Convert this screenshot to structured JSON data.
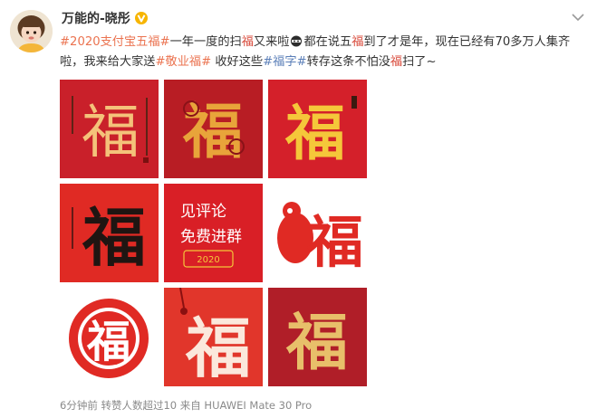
{
  "post": {
    "username": "万能的-晓彤",
    "verified_icon": "gold-verified-badge",
    "menu_icon": "chevron-down-icon",
    "text": {
      "tag1": "#2020支付宝五福#",
      "seg1": "一年一度的扫",
      "fu1": "福",
      "seg2": "又来啦",
      "emoji": "face-emoji",
      "seg3": "都在说五",
      "fu2": "福",
      "seg4": "到了才是年，现在已经有70多万人集齐啦，我来给大家送",
      "tag2": "#敬业福#",
      "seg5": " 收好这些",
      "tag3": "#福字#",
      "seg6": "转存这条不怕没",
      "fu3": "福",
      "seg7": "扫了~"
    },
    "images": [
      {
        "name": "calligraphy-fu-gold",
        "glyph": "福",
        "bg": "#c9202a",
        "fg": "#f4c27a"
      },
      {
        "name": "papercut-fu-gold",
        "glyph": "福",
        "bg": "#b81d24",
        "fg": "#e8a43a"
      },
      {
        "name": "gold-fu-character",
        "glyph": "福",
        "bg": "#d4202a",
        "fg": "#f5c73a"
      },
      {
        "name": "black-ink-fu",
        "glyph": "福",
        "bg": "#e02a24",
        "fg": "#1f1512"
      },
      {
        "name": "see-comments-promo",
        "line1": "见评论",
        "line2": "免费进群",
        "stamp": "2020",
        "bg": "#d91f26",
        "fg": "#ffffff"
      },
      {
        "name": "rat-papercut-fu",
        "glyph": "福",
        "bg": "#ffffff",
        "fg": "#e02a24"
      },
      {
        "name": "round-papercut-fu",
        "glyph": "福",
        "bg": "#ffffff",
        "fg": "#e02a24"
      },
      {
        "name": "white-brush-fu",
        "glyph": "福",
        "bg": "#e1362b",
        "fg": "#fbe8dc"
      },
      {
        "name": "golden-brush-fu",
        "glyph": "福",
        "bg": "#b01e28",
        "fg": "#e8bf6a"
      }
    ],
    "meta": {
      "time": "6分钟前",
      "reposts": "转赞人数超过10",
      "source": "来自 HUAWEI Mate 30 Pro"
    }
  }
}
